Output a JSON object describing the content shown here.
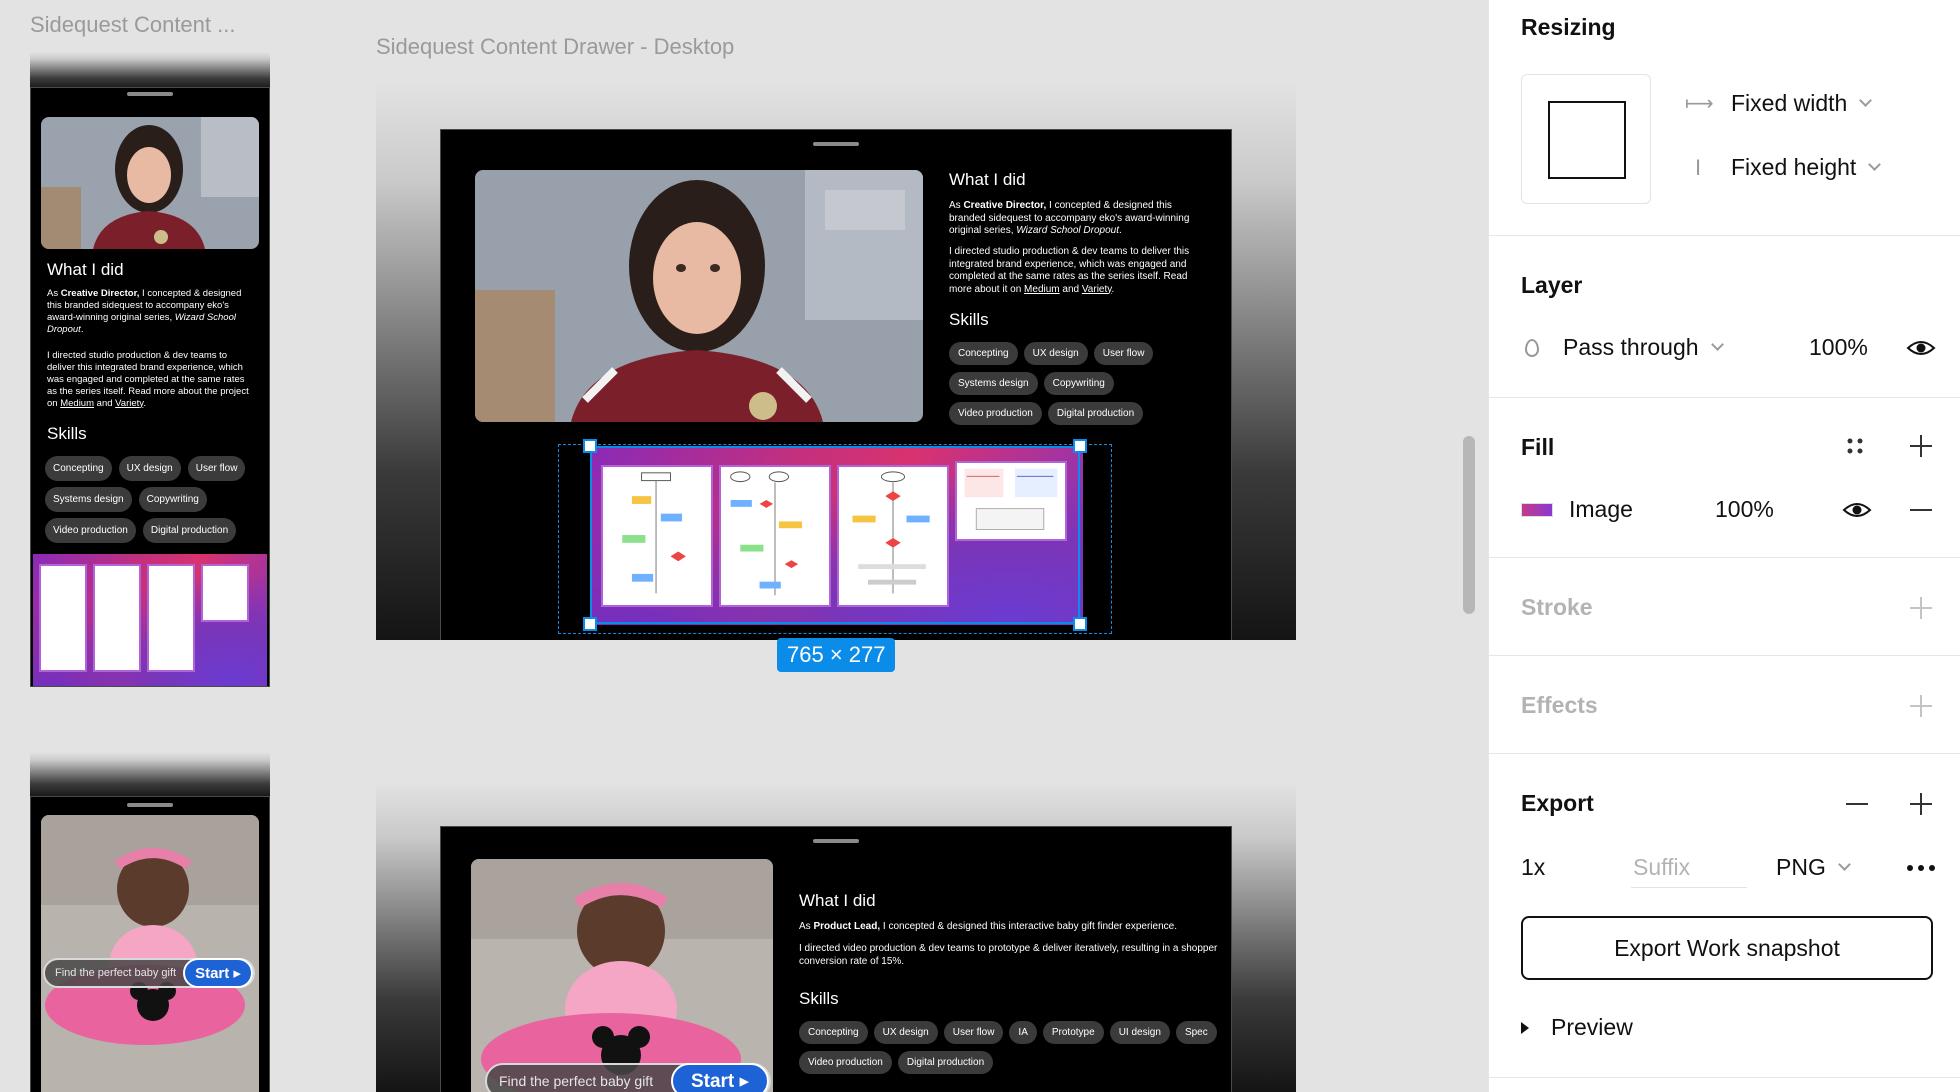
{
  "frames": {
    "mobile_label": "Sidequest Content ...",
    "desktop_label": "Sidequest Content Drawer - Desktop"
  },
  "card1": {
    "heading": "What I did",
    "p1_pre": "As ",
    "p1_bold": "Creative Director,",
    "p1_mid": " I concepted & designed this branded sidequest to accompany eko's award-winning original series, ",
    "p1_italic": "Wizard School Dropout",
    "p1_end": ".",
    "p2_pre": "I directed studio production & dev teams to deliver this integrated brand experience, which was engaged and completed at the same rates as the series itself. Read more about it on ",
    "p2_link1": "Medium",
    "p2_and": " and ",
    "p2_link2": "Variety",
    "p2_end": ".",
    "m_p2_pre": "I directed studio production & dev teams to deliver this integrated brand experience, which was engaged and completed at the same rates as the series itself. Read more about the project on ",
    "skills_heading": "Skills",
    "skills": [
      "Concepting",
      "UX design",
      "User flow",
      "Systems design",
      "Copywriting",
      "Video production",
      "Digital production"
    ]
  },
  "selection": {
    "size_label": "765 × 277"
  },
  "card2": {
    "heading": "What I did",
    "p1_pre": "As ",
    "p1_bold": "Product Lead,",
    "p1_end": " I concepted & designed this interactive baby gift finder experience.",
    "p2": "I directed video production & dev teams to prototype & deliver iteratively, resulting in a shopper conversion rate of 15%.",
    "skills_heading": "Skills",
    "skills": [
      "Concepting",
      "UX design",
      "User flow",
      "IA",
      "Prototype",
      "UI design",
      "Spec",
      "Video production",
      "Digital production"
    ],
    "cta_text": "Find the perfect baby gift",
    "cta_start": "Start ▸"
  },
  "panel": {
    "resizing": {
      "title": "Resizing",
      "width_mode": "Fixed width",
      "height_mode": "Fixed height"
    },
    "layer": {
      "title": "Layer",
      "blend": "Pass through",
      "opacity": "100%"
    },
    "fill": {
      "title": "Fill",
      "type": "Image",
      "opacity": "100%"
    },
    "stroke": {
      "title": "Stroke"
    },
    "effects": {
      "title": "Effects"
    },
    "export": {
      "title": "Export",
      "scale": "1x",
      "suffix_placeholder": "Suffix",
      "format": "PNG",
      "button": "Export Work snapshot",
      "preview": "Preview"
    }
  },
  "colors": {
    "accent": "#0c8ce9",
    "chip_bg": "#3b3b3b",
    "cta_blue": "#1e63d6"
  },
  "icons": [
    "fixed-width-icon",
    "fixed-height-icon",
    "blend-drop-icon",
    "eye-icon",
    "styles-grid-icon",
    "plus-icon",
    "minus-icon",
    "more-icon",
    "caret-right-icon"
  ]
}
